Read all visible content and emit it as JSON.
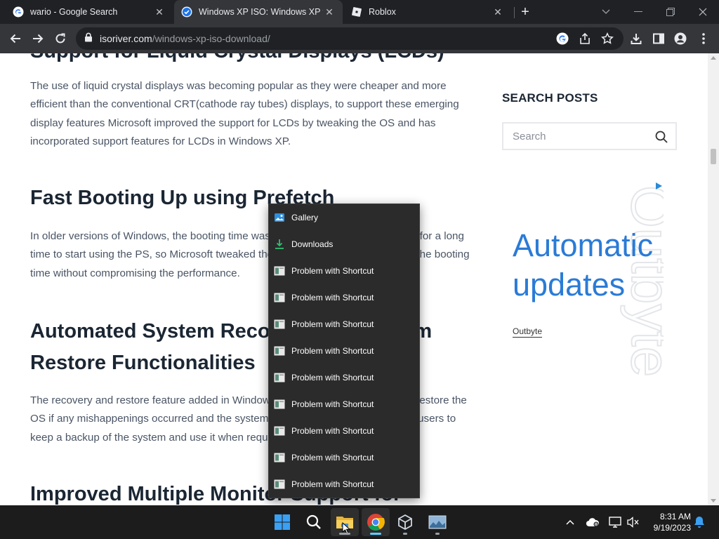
{
  "browser": {
    "tabs": [
      {
        "title": "wario - Google Search",
        "favicon": "google-g-icon",
        "active": false
      },
      {
        "title": "Windows XP ISO: Windows XP fr",
        "favicon": "isoriver-check-icon",
        "active": true
      },
      {
        "title": "Roblox",
        "favicon": "roblox-icon",
        "active": false
      }
    ],
    "url_domain": "isoriver.com",
    "url_path": "/windows-xp-iso-download/"
  },
  "article": {
    "sections": [
      {
        "heading": "Support for Liquid Crystal Displays (LCDs)",
        "body": "The use of liquid crystal displays was becoming popular as they were cheaper and more efficient than the conventional CRT(cathode ray tubes) displays, to support these emerging display features Microsoft improved the support for LCDs by tweaking the OS and has incorporated support features for LCDs in Windows XP."
      },
      {
        "heading": "Fast Booting Up using Prefetch",
        "body": "In older versions of Windows, the booting time was too slow and users had to wait for a long time to start using the PS, so Microsoft tweaked the booting process and reduced the booting time without compromising the performance."
      },
      {
        "heading_line1": "Automated System Recovery and System",
        "heading_line2": "Restore Functionalities",
        "body": "The recovery and restore feature added in Windows XP helps users to recover or restore the OS if any mishappenings occurred and the system backup feature also allows the users to keep a backup of the system and use it when required."
      },
      {
        "heading": "Improved Multiple Monitor Support for"
      }
    ]
  },
  "sidebar": {
    "title": "SEARCH POSTS",
    "search_placeholder": "Search"
  },
  "ad": {
    "headline": "Automatic updates",
    "brand": "Outbyte",
    "watermark": "Outbyte"
  },
  "jumplist": {
    "items": [
      {
        "label": "Gallery",
        "icon": "gallery-icon"
      },
      {
        "label": "Downloads",
        "icon": "downloads-icon"
      },
      {
        "label": "Problem with Shortcut",
        "icon": "shortcut-icon"
      },
      {
        "label": "Problem with Shortcut",
        "icon": "shortcut-icon"
      },
      {
        "label": "Problem with Shortcut",
        "icon": "shortcut-icon"
      },
      {
        "label": "Problem with Shortcut",
        "icon": "shortcut-icon"
      },
      {
        "label": "Problem with Shortcut",
        "icon": "shortcut-icon"
      },
      {
        "label": "Problem with Shortcut",
        "icon": "shortcut-icon"
      },
      {
        "label": "Problem with Shortcut",
        "icon": "shortcut-icon"
      },
      {
        "label": "Problem with Shortcut",
        "icon": "shortcut-icon"
      },
      {
        "label": "Problem with Shortcut",
        "icon": "shortcut-icon"
      }
    ]
  },
  "taskbar": {
    "apps": [
      "windows-start-icon",
      "search-icon",
      "file-explorer-icon",
      "chrome-icon",
      "virtualbox-icon",
      "photos-icon"
    ],
    "time": "8:31 AM",
    "date": "9/19/2023"
  },
  "colors": {
    "accent_blue": "#2a7bd6",
    "chrome_dark": "#202124",
    "taskbar": "#1c1c1c"
  }
}
